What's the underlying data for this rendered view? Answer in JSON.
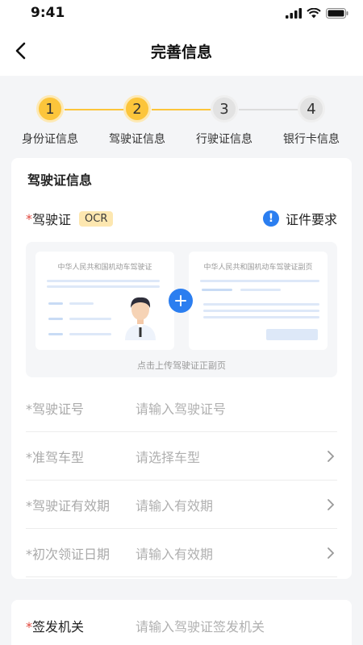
{
  "status": {
    "time": "9:41"
  },
  "nav": {
    "title": "完善信息"
  },
  "steps": [
    {
      "number": "1",
      "label": "身份证信息",
      "state": "active"
    },
    {
      "number": "2",
      "label": "驾驶证信息",
      "state": "active"
    },
    {
      "number": "3",
      "label": "行驶证信息",
      "state": "inactive"
    },
    {
      "number": "4",
      "label": "银行卡信息",
      "state": "inactive"
    }
  ],
  "section": {
    "title": "驾驶证信息",
    "license_label": "驾驶证",
    "required_mark": "*",
    "ocr_badge": "OCR",
    "requirements_link": "证件要求",
    "info_icon_glyph": "!"
  },
  "upload": {
    "front_title": "中华人民共和国机动车驾驶证",
    "back_title": "中华人民共和国机动车驾驶证副页",
    "hint": "点击上传驾驶证正副页"
  },
  "fields": [
    {
      "label": "*驾驶证号",
      "placeholder": "请输入驾驶证号",
      "has_chevron": false
    },
    {
      "label": "*准驾车型",
      "placeholder": "请选择车型",
      "has_chevron": true
    },
    {
      "label": "*驾驶证有效期",
      "placeholder": "请输入有效期",
      "has_chevron": true
    },
    {
      "label": "*初次领证日期",
      "placeholder": "请输入有效期",
      "has_chevron": true
    }
  ],
  "second_card": {
    "required_mark": "*",
    "label": "签发机关",
    "placeholder": "请输入驾驶证签发机关"
  },
  "colors": {
    "accent_yellow": "#fcc53b",
    "accent_blue": "#2b7ef0",
    "required_red": "#e0483e",
    "inactive_gray": "#e2e2e2"
  },
  "icons": [
    "signal-icon",
    "wifi-icon",
    "battery-icon",
    "back-chevron-icon",
    "info-icon",
    "plus-icon",
    "chevron-right-icon"
  ]
}
